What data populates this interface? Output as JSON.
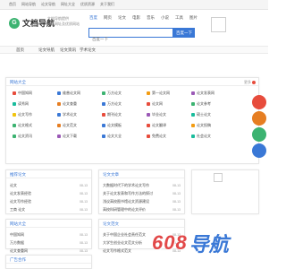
{
  "topbar": {
    "links": [
      "首页",
      "网站导航",
      "论文导航",
      "网址大全",
      "优质资源",
      "关于我们"
    ]
  },
  "brand": {
    "logo_letter": "G",
    "name": "文档导航",
    "slogan": [
      "文档导航提供",
      "精选网址及优质网站"
    ]
  },
  "search": {
    "tabs": [
      {
        "label": "百度",
        "active": true
      },
      {
        "label": "网页",
        "active": false
      },
      {
        "label": "论文",
        "active": false
      },
      {
        "label": "电影",
        "active": false
      },
      {
        "label": "音乐",
        "active": false
      },
      {
        "label": "小说",
        "active": false
      },
      {
        "label": "工具",
        "active": false
      },
      {
        "label": "图片",
        "active": false
      }
    ],
    "placeholder": "百度一下",
    "button_label": "百度一下"
  },
  "nav": {
    "items": [
      "首页",
      "论文导航",
      "论文资讯",
      "学术论文",
      "优质资源",
      "网址大全"
    ]
  },
  "categories": {
    "title": "网站大全",
    "more": "更多",
    "items": [
      {
        "label": "中国知网",
        "color": "#e74c3c"
      },
      {
        "label": "维普论文网",
        "color": "#3a78d6"
      },
      {
        "label": "万方论文",
        "color": "#3cb371"
      },
      {
        "label": "第一论文网",
        "color": "#f39c12"
      },
      {
        "label": "论文发表网",
        "color": "#9b59b6"
      },
      {
        "label": "读秀网",
        "color": "#1abc9c"
      },
      {
        "label": "论文查重",
        "color": "#e67e22"
      },
      {
        "label": "万方论文",
        "color": "#3a78d6"
      },
      {
        "label": "论文网",
        "color": "#e74c3c"
      },
      {
        "label": "论文参考",
        "color": "#3cb371"
      },
      {
        "label": "论文写作",
        "color": "#f1c40f"
      },
      {
        "label": "学术论文",
        "color": "#3a78d6"
      },
      {
        "label": "期刊论文",
        "color": "#e74c3c"
      },
      {
        "label": "毕业论文",
        "color": "#9b59b6"
      },
      {
        "label": "硕士论文",
        "color": "#1abc9c"
      },
      {
        "label": "论文格式",
        "color": "#3cb371"
      },
      {
        "label": "论文范文",
        "color": "#e67e22"
      },
      {
        "label": "论文模板",
        "color": "#3a78d6"
      },
      {
        "label": "论文翻译",
        "color": "#e74c3c"
      },
      {
        "label": "论文投稿",
        "color": "#f39c12"
      },
      {
        "label": "论文资讯",
        "color": "#3cb371"
      },
      {
        "label": "论文下载",
        "color": "#9b59b6"
      },
      {
        "label": "论文大全",
        "color": "#3a78d6"
      },
      {
        "label": "免费论文",
        "color": "#e74c3c"
      },
      {
        "label": "社会论文",
        "color": "#1abc9c"
      }
    ]
  },
  "panels": {
    "recommend": {
      "title": "推荐论文",
      "rows": [
        {
          "title": "论文",
          "date": "08-13"
        },
        {
          "title": "论文发表经验",
          "date": "08-13"
        },
        {
          "title": "论文写作经验",
          "date": "08-13"
        },
        {
          "title": "工商 论文",
          "date": "08-13"
        }
      ]
    },
    "latest": {
      "title": "论文文章",
      "rows": [
        {
          "title": "大数据时代下的学术论文写作",
          "date": "08-13"
        },
        {
          "title": "关于论文发表和写作方法的探讨",
          "date": "08-13"
        },
        {
          "title": "浅议高校图书馆论文资源建设",
          "date": "08-13"
        },
        {
          "title": "高校科研管理中的论文评价",
          "date": "08-13"
        }
      ]
    },
    "sites": {
      "title": "网站大全",
      "rows": [
        {
          "title": "中国知网",
          "date": "08-13"
        },
        {
          "title": "万方数据",
          "date": "08-13"
        },
        {
          "title": "论文查重网",
          "date": "08-13"
        }
      ]
    },
    "articles": {
      "title": "论文范文",
      "rows": [
        {
          "title": "关于中国企业社会责任范文",
          "date": "08-13"
        },
        {
          "title": "大学生创业论文范文分析",
          "date": "08-13"
        },
        {
          "title": "论文写作格式范文",
          "date": "08-13"
        }
      ]
    },
    "ads": {
      "title": "广告合作"
    }
  },
  "watermark": {
    "text": "608",
    "tail": "导航"
  },
  "colors": {
    "accent": "#3a78d6",
    "brand": "#3cb371",
    "float_red": "#e74c3c",
    "float_orange": "#e67e22"
  }
}
